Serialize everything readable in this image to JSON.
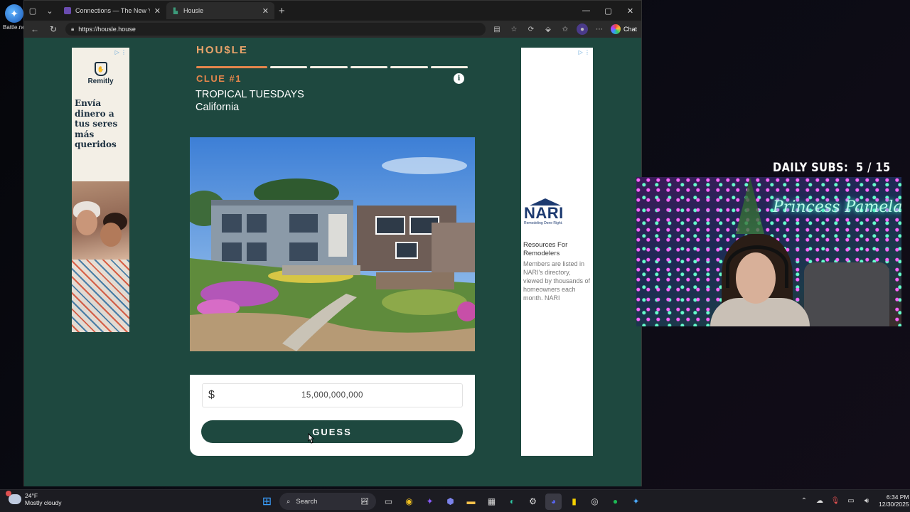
{
  "desktop": {
    "icon_label": "Battle.net"
  },
  "browser": {
    "tabs": [
      {
        "title": "Connections — The New York Times",
        "active": false
      },
      {
        "title": "Housle",
        "active": true
      }
    ],
    "url": "https://housle.house",
    "chat_label": "Chat"
  },
  "game": {
    "logo": "HOU$LE",
    "progress": {
      "total_segments": 6,
      "current": 1
    },
    "clue_label": "CLUE #1",
    "clue_lines": [
      "TROPICAL TUESDAYS",
      "California"
    ],
    "currency_symbol": "$",
    "guess_value": "15,000,000,000",
    "guess_button": "GUESS"
  },
  "ads": {
    "left": {
      "brand": "Remitly",
      "headline_lines": [
        "Envía",
        "dinero a",
        "tus seres",
        "más",
        "queridos"
      ]
    },
    "right": {
      "brand": "NARI",
      "tagline": "Remodeling Done Right.",
      "title": "Resources For Remodelers",
      "body": "Members are listed in NARI's directory, viewed by thousands of homeowners each month. NARI"
    }
  },
  "stream": {
    "subs_label": "DAILY SUBS:",
    "subs_value": "5 / 15",
    "neon_sign": "Princess Pamela"
  },
  "taskbar": {
    "weather_temp": "24°F",
    "weather_desc": "Mostly cloudy",
    "search_label": "Search",
    "time": "6:34 PM",
    "date": "12/30/2025"
  },
  "colors": {
    "site_bg": "#1e483f",
    "accent": "#e6864c",
    "card": "#ffffff"
  }
}
